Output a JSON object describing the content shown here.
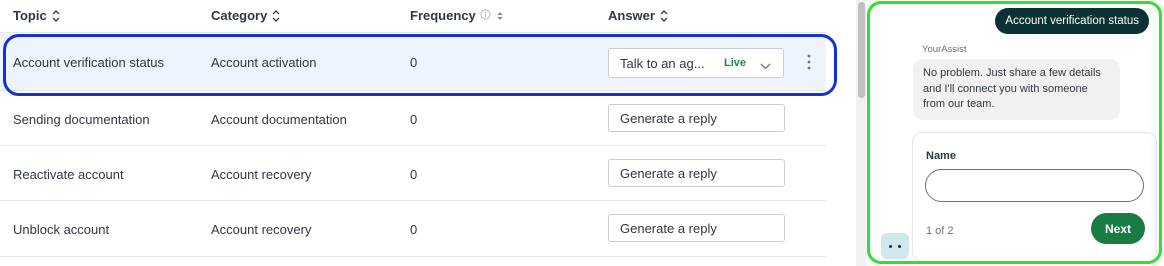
{
  "table": {
    "columns": {
      "topic": "Topic",
      "category": "Category",
      "frequency": "Frequency",
      "answer": "Answer"
    },
    "rows": [
      {
        "topic": "Account verification status",
        "category": "Account activation",
        "frequency": "0",
        "answer": "Talk to an ag...",
        "answer_status": "Live",
        "selected": true
      },
      {
        "topic": "Sending documentation",
        "category": "Account documentation",
        "frequency": "0",
        "answer": "Generate a reply"
      },
      {
        "topic": "Reactivate account",
        "category": "Account recovery",
        "frequency": "0",
        "answer": "Generate a reply"
      },
      {
        "topic": "Unblock account",
        "category": "Account recovery",
        "frequency": "0",
        "answer": "Generate a reply"
      }
    ]
  },
  "chat": {
    "user_message": "Account verification status",
    "bot_name": "YourAssist",
    "bot_message": "No problem. Just share a few details and I'll connect you with someone from our team.",
    "form": {
      "field_label": "Name",
      "field_value": "",
      "step": "1 of 2",
      "next_label": "Next"
    }
  },
  "colors": {
    "highlight_selected_row": "#1531d6",
    "highlight_chat": "#2fe02f",
    "live": "#1f8a4c",
    "next_button": "#187c44",
    "user_bubble": "#0a3235"
  }
}
